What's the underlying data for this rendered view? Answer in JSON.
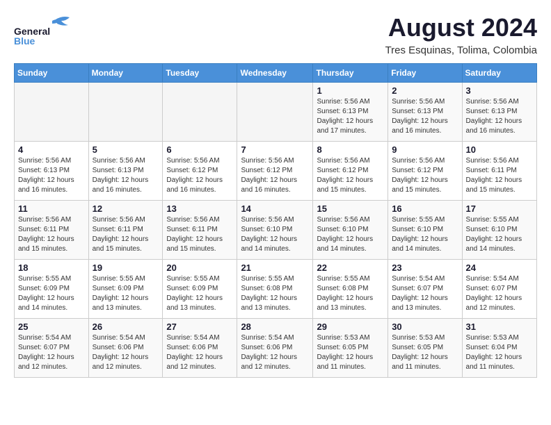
{
  "header": {
    "logo_line1": "General",
    "logo_line2": "Blue",
    "month_title": "August 2024",
    "location": "Tres Esquinas, Tolima, Colombia"
  },
  "weekdays": [
    "Sunday",
    "Monday",
    "Tuesday",
    "Wednesday",
    "Thursday",
    "Friday",
    "Saturday"
  ],
  "weeks": [
    [
      {
        "day": "",
        "info": ""
      },
      {
        "day": "",
        "info": ""
      },
      {
        "day": "",
        "info": ""
      },
      {
        "day": "",
        "info": ""
      },
      {
        "day": "1",
        "info": "Sunrise: 5:56 AM\nSunset: 6:13 PM\nDaylight: 12 hours\nand 17 minutes."
      },
      {
        "day": "2",
        "info": "Sunrise: 5:56 AM\nSunset: 6:13 PM\nDaylight: 12 hours\nand 16 minutes."
      },
      {
        "day": "3",
        "info": "Sunrise: 5:56 AM\nSunset: 6:13 PM\nDaylight: 12 hours\nand 16 minutes."
      }
    ],
    [
      {
        "day": "4",
        "info": "Sunrise: 5:56 AM\nSunset: 6:13 PM\nDaylight: 12 hours\nand 16 minutes."
      },
      {
        "day": "5",
        "info": "Sunrise: 5:56 AM\nSunset: 6:13 PM\nDaylight: 12 hours\nand 16 minutes."
      },
      {
        "day": "6",
        "info": "Sunrise: 5:56 AM\nSunset: 6:12 PM\nDaylight: 12 hours\nand 16 minutes."
      },
      {
        "day": "7",
        "info": "Sunrise: 5:56 AM\nSunset: 6:12 PM\nDaylight: 12 hours\nand 16 minutes."
      },
      {
        "day": "8",
        "info": "Sunrise: 5:56 AM\nSunset: 6:12 PM\nDaylight: 12 hours\nand 15 minutes."
      },
      {
        "day": "9",
        "info": "Sunrise: 5:56 AM\nSunset: 6:12 PM\nDaylight: 12 hours\nand 15 minutes."
      },
      {
        "day": "10",
        "info": "Sunrise: 5:56 AM\nSunset: 6:11 PM\nDaylight: 12 hours\nand 15 minutes."
      }
    ],
    [
      {
        "day": "11",
        "info": "Sunrise: 5:56 AM\nSunset: 6:11 PM\nDaylight: 12 hours\nand 15 minutes."
      },
      {
        "day": "12",
        "info": "Sunrise: 5:56 AM\nSunset: 6:11 PM\nDaylight: 12 hours\nand 15 minutes."
      },
      {
        "day": "13",
        "info": "Sunrise: 5:56 AM\nSunset: 6:11 PM\nDaylight: 12 hours\nand 15 minutes."
      },
      {
        "day": "14",
        "info": "Sunrise: 5:56 AM\nSunset: 6:10 PM\nDaylight: 12 hours\nand 14 minutes."
      },
      {
        "day": "15",
        "info": "Sunrise: 5:56 AM\nSunset: 6:10 PM\nDaylight: 12 hours\nand 14 minutes."
      },
      {
        "day": "16",
        "info": "Sunrise: 5:55 AM\nSunset: 6:10 PM\nDaylight: 12 hours\nand 14 minutes."
      },
      {
        "day": "17",
        "info": "Sunrise: 5:55 AM\nSunset: 6:10 PM\nDaylight: 12 hours\nand 14 minutes."
      }
    ],
    [
      {
        "day": "18",
        "info": "Sunrise: 5:55 AM\nSunset: 6:09 PM\nDaylight: 12 hours\nand 14 minutes."
      },
      {
        "day": "19",
        "info": "Sunrise: 5:55 AM\nSunset: 6:09 PM\nDaylight: 12 hours\nand 13 minutes."
      },
      {
        "day": "20",
        "info": "Sunrise: 5:55 AM\nSunset: 6:09 PM\nDaylight: 12 hours\nand 13 minutes."
      },
      {
        "day": "21",
        "info": "Sunrise: 5:55 AM\nSunset: 6:08 PM\nDaylight: 12 hours\nand 13 minutes."
      },
      {
        "day": "22",
        "info": "Sunrise: 5:55 AM\nSunset: 6:08 PM\nDaylight: 12 hours\nand 13 minutes."
      },
      {
        "day": "23",
        "info": "Sunrise: 5:54 AM\nSunset: 6:07 PM\nDaylight: 12 hours\nand 13 minutes."
      },
      {
        "day": "24",
        "info": "Sunrise: 5:54 AM\nSunset: 6:07 PM\nDaylight: 12 hours\nand 12 minutes."
      }
    ],
    [
      {
        "day": "25",
        "info": "Sunrise: 5:54 AM\nSunset: 6:07 PM\nDaylight: 12 hours\nand 12 minutes."
      },
      {
        "day": "26",
        "info": "Sunrise: 5:54 AM\nSunset: 6:06 PM\nDaylight: 12 hours\nand 12 minutes."
      },
      {
        "day": "27",
        "info": "Sunrise: 5:54 AM\nSunset: 6:06 PM\nDaylight: 12 hours\nand 12 minutes."
      },
      {
        "day": "28",
        "info": "Sunrise: 5:54 AM\nSunset: 6:06 PM\nDaylight: 12 hours\nand 12 minutes."
      },
      {
        "day": "29",
        "info": "Sunrise: 5:53 AM\nSunset: 6:05 PM\nDaylight: 12 hours\nand 11 minutes."
      },
      {
        "day": "30",
        "info": "Sunrise: 5:53 AM\nSunset: 6:05 PM\nDaylight: 12 hours\nand 11 minutes."
      },
      {
        "day": "31",
        "info": "Sunrise: 5:53 AM\nSunset: 6:04 PM\nDaylight: 12 hours\nand 11 minutes."
      }
    ]
  ]
}
